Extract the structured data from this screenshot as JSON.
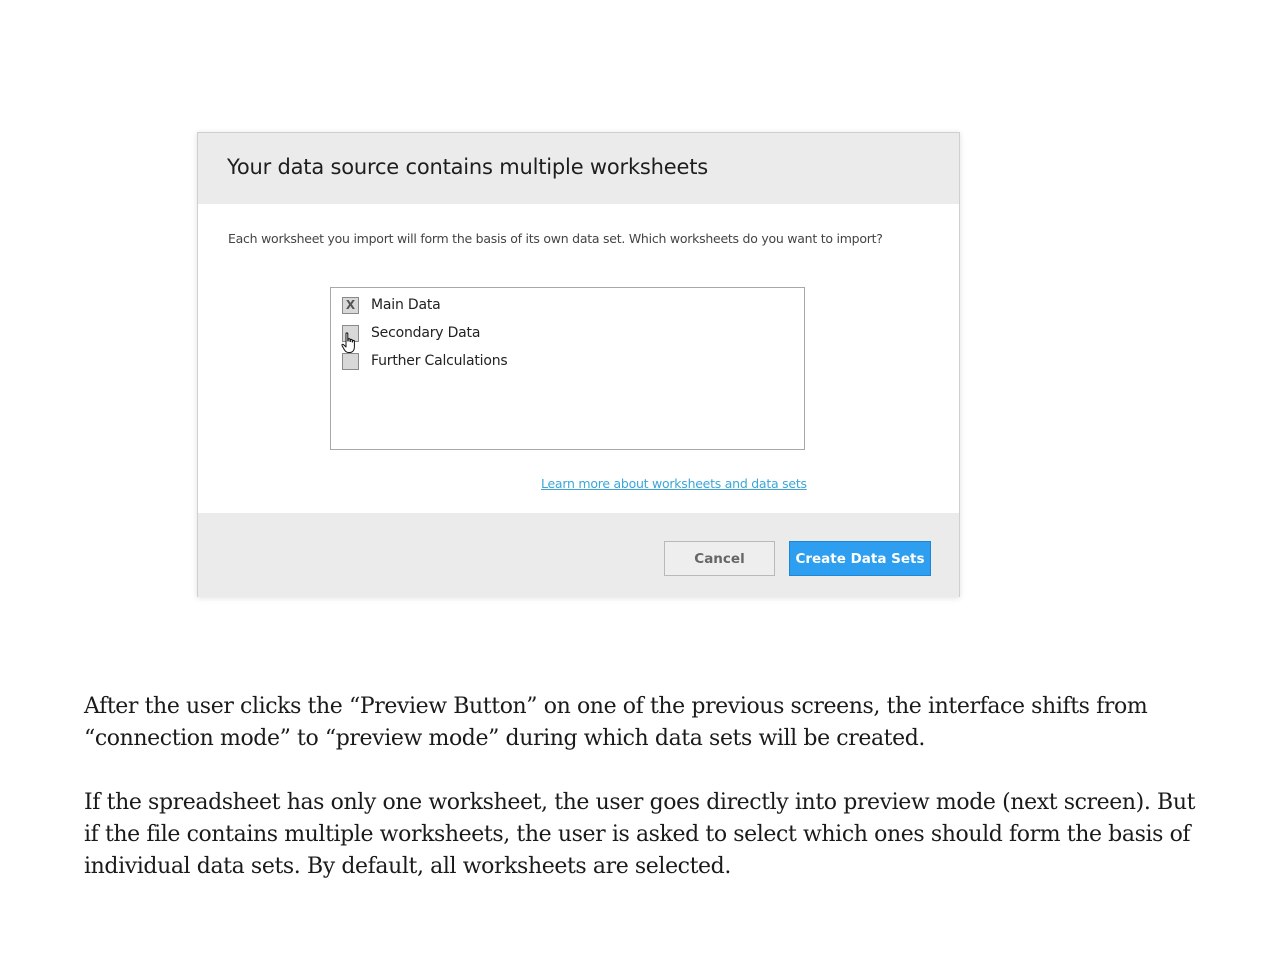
{
  "dialog": {
    "title": "Your data source contains multiple worksheets",
    "description": "Each worksheet you import will form the basis of its own data set.  Which worksheets do you want to import?",
    "worksheets": [
      {
        "label": "Main Data",
        "checked": true,
        "mark": "X"
      },
      {
        "label": "Secondary Data",
        "checked": false,
        "mark": ""
      },
      {
        "label": "Further Calculations",
        "checked": false,
        "mark": ""
      }
    ],
    "learn_more_link": "Learn more about worksheets and data sets",
    "cancel_label": "Cancel",
    "create_label": "Create Data Sets",
    "colors": {
      "header_bg": "#ebebeb",
      "link": "#3aa6d9",
      "primary_button": "#2e9ff0"
    }
  },
  "notes": {
    "paragraph_1": "After the user clicks the “Preview Button” on one of the previous screens, the interface shifts from “connection mode” to “preview mode” during which data sets will be created.",
    "paragraph_2": "If the spreadsheet has only one worksheet, the user goes directly into preview mode (next screen).  But if the file contains multiple worksheets, the user is asked to select which ones should form the basis of individual data sets.  By default, all worksheets are selected."
  }
}
